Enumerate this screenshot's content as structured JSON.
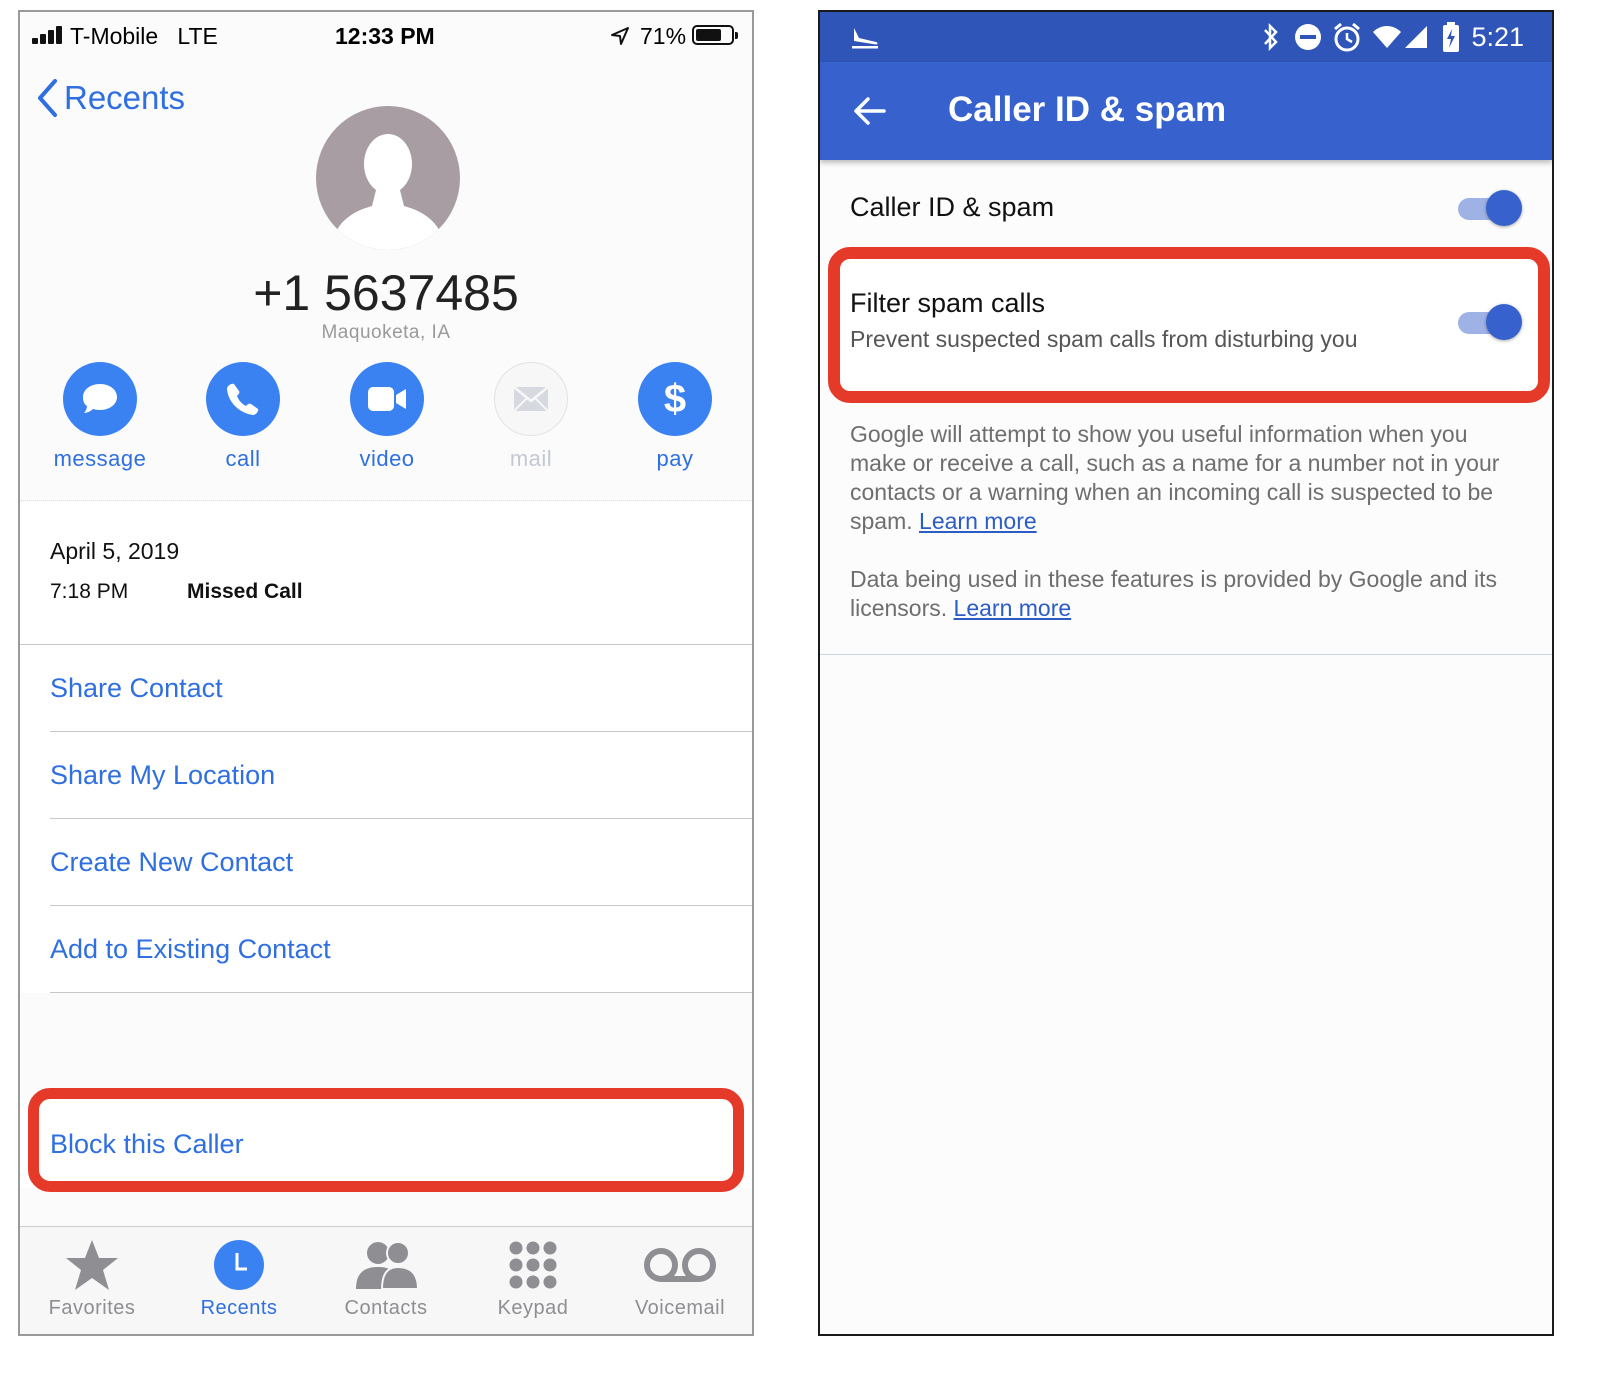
{
  "ios": {
    "status": {
      "carrier": "T-Mobile",
      "network": "LTE",
      "time": "12:33 PM",
      "battery": "71%"
    },
    "back_label": "Recents",
    "contact": {
      "number": "+1 5637485",
      "location": "Maquoketa, IA"
    },
    "actions": [
      {
        "label": "message",
        "icon": "message-icon",
        "enabled": true
      },
      {
        "label": "call",
        "icon": "phone-icon",
        "enabled": true
      },
      {
        "label": "video",
        "icon": "video-icon",
        "enabled": true
      },
      {
        "label": "mail",
        "icon": "mail-icon",
        "enabled": false
      },
      {
        "label": "pay",
        "icon": "dollar-icon",
        "enabled": true
      }
    ],
    "call_log": {
      "date": "April 5, 2019",
      "time": "7:18 PM",
      "type": "Missed Call"
    },
    "menu": [
      "Share Contact",
      "Share My Location",
      "Create New Contact",
      "Add to Existing Contact"
    ],
    "block_label": "Block this Caller",
    "tabs": [
      {
        "label": "Favorites",
        "icon": "star-icon",
        "active": false
      },
      {
        "label": "Recents",
        "icon": "clock-icon",
        "active": true
      },
      {
        "label": "Contacts",
        "icon": "contacts-icon",
        "active": false
      },
      {
        "label": "Keypad",
        "icon": "keypad-icon",
        "active": false
      },
      {
        "label": "Voicemail",
        "icon": "voicemail-icon",
        "active": false
      }
    ],
    "colors": {
      "accent": "#2f6fe0",
      "highlight": "#e5392a"
    }
  },
  "android": {
    "status": {
      "time": "5:21"
    },
    "title": "Caller ID & spam",
    "setting_caller_id": {
      "label": "Caller ID & spam",
      "enabled": true
    },
    "setting_filter": {
      "title": "Filter spam calls",
      "subtitle": "Prevent suspected spam calls from disturbing you",
      "enabled": true
    },
    "desc1": "Google will attempt to show you useful information when you make or receive a call, such as a name for a number not in your contacts or a warning when an incoming call is suspected to be spam.",
    "desc2": "Data being used in these features is provided by Google and its licensors.",
    "learn_more": "Learn more",
    "colors": {
      "primary": "#3761cc",
      "status_bar": "#2f55b9",
      "highlight": "#e5392a"
    }
  }
}
